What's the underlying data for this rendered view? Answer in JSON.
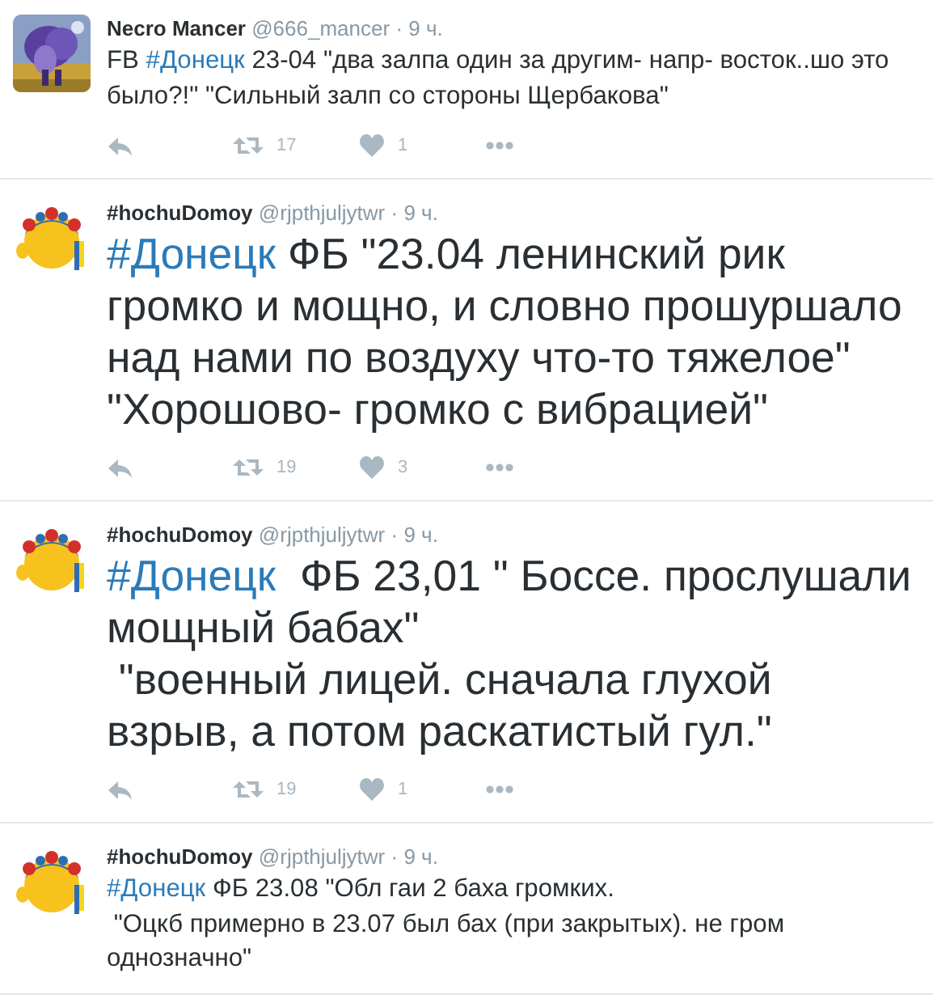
{
  "tweets": [
    {
      "kind": "normal-text",
      "name": "Necro Mancer",
      "handle": "@666_mancer",
      "time": "· 9 ч.",
      "hashtag_prefix": "FB ",
      "hashtag": "#Донецк",
      "text": " 23-04 \"два залпа один за другим- напр- восток..шо это было?!\" \"Сильный залп со стороны Щербакова\"",
      "retweets": "17",
      "likes": "1"
    },
    {
      "kind": "large-text",
      "avatar": {
        "kind": "emoji"
      },
      "name": "#hochuDomoy",
      "handle": "@rjpthjuljytwr",
      "time": "· 9 ч.",
      "hashtag": "#Донецк",
      "text": " ФБ \"23.04 ленинский рик громко и мощно, и словно прошуршало над нами по воздуху что-то тяжелое\" \"Хорошово- громко с вибрацией\"",
      "retweets": "19",
      "likes": "3"
    },
    {
      "kind": "large-text",
      "avatar": {
        "kind": "emoji"
      },
      "name": "#hochuDomoy",
      "handle": "@rjpthjuljytwr",
      "time": "· 9 ч.",
      "hashtag": "#Донецк",
      "text": "  ФБ 23,01 \" Боссе. прослушали мощный бабах\"\n \"военный лицей. сначала глухой взрыв, а потом раскатистый гул.\"",
      "retweets": "19",
      "likes": "1"
    },
    {
      "kind": "normal-text",
      "avatar": {
        "kind": "emoji"
      },
      "name": "#hochuDomoy",
      "handle": "@rjpthjuljytwr",
      "time": "· 9 ч.",
      "hashtag": "#Донецк",
      "text": " ФБ 23.08 \"Обл гаи 2 баха громких.\n \"Оцкб примерно в 23.07 был бах (при закрытых). не гром однозначно\""
    }
  ]
}
